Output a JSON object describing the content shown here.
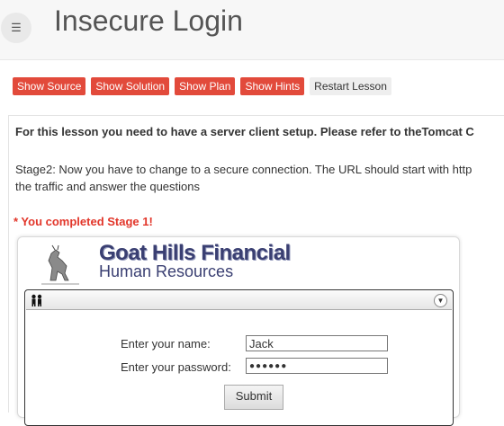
{
  "header": {
    "title": "Insecure Login",
    "menu_icon": "hamburger-icon"
  },
  "toolbar": {
    "show_source": "Show Source",
    "show_solution": "Show Solution",
    "show_plan": "Show Plan",
    "show_hints": "Show Hints",
    "restart": "Restart Lesson"
  },
  "lesson": {
    "intro": "For this lesson you need to have a server client setup. Please refer to theTomcat C",
    "stage_line1": "Stage2: Now you have to change to a secure connection. The URL should start with http",
    "stage_line2": "the traffic and answer the questions",
    "completed": "* You completed Stage 1!"
  },
  "brand": {
    "title": "Goat Hills Financial",
    "subtitle": "Human Resources"
  },
  "form": {
    "name_label": "Enter your name:",
    "name_value": "Jack",
    "password_label": "Enter your password:",
    "password_value": "●●●●●●",
    "submit_label": "Submit"
  },
  "colors": {
    "accent": "#e24a3b",
    "completed": "#e2362a",
    "brand": "#3a3f72"
  }
}
